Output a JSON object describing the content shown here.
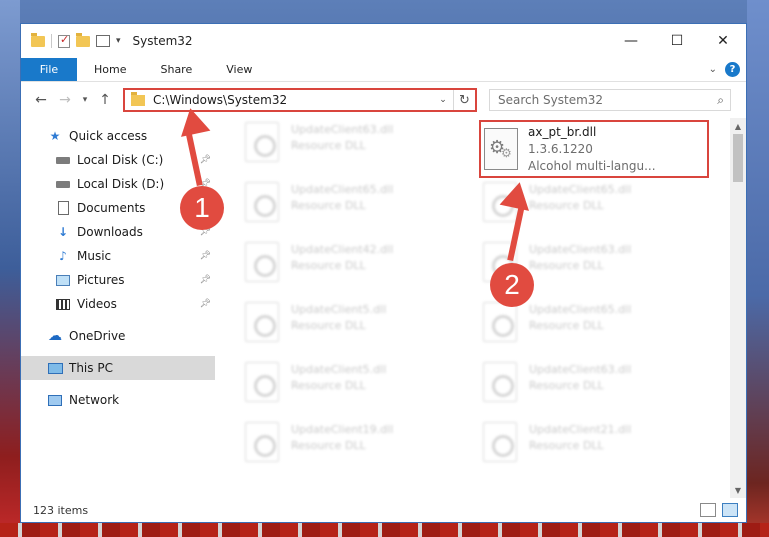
{
  "window": {
    "title": "System32",
    "controls": {
      "minimize": "—",
      "maximize": "☐",
      "close": "✕"
    }
  },
  "ribbon": {
    "tabs": [
      "File",
      "Home",
      "Share",
      "View"
    ],
    "help": "?"
  },
  "address": {
    "path": "C:\\Windows\\System32",
    "search_placeholder": "Search System32"
  },
  "sidebar": {
    "items": [
      {
        "label": "Quick access",
        "icon": "star-icon"
      },
      {
        "label": "Local Disk (C:)",
        "icon": "drive-icon"
      },
      {
        "label": "Local Disk (D:)",
        "icon": "drive-icon"
      },
      {
        "label": "Documents",
        "icon": "documents-icon"
      },
      {
        "label": "Downloads",
        "icon": "download-icon"
      },
      {
        "label": "Music",
        "icon": "music-icon"
      },
      {
        "label": "Pictures",
        "icon": "pictures-icon"
      },
      {
        "label": "Videos",
        "icon": "videos-icon"
      },
      {
        "label": "OneDrive",
        "icon": "cloud-icon"
      },
      {
        "label": "This PC",
        "icon": "computer-icon"
      },
      {
        "label": "Network",
        "icon": "network-icon"
      }
    ]
  },
  "files": {
    "ghost_left": [
      {
        "name": "UpdateClient63.dll",
        "type": "Resource DLL"
      },
      {
        "name": "UpdateClient65.dll",
        "type": "Resource DLL"
      },
      {
        "name": "UpdateClient42.dll",
        "type": "Resource DLL"
      },
      {
        "name": "UpdateClient5.dll",
        "type": "Resource DLL"
      },
      {
        "name": "UpdateClient5.dll",
        "type": "Resource DLL"
      },
      {
        "name": "UpdateClient19.dll",
        "type": "Resource DLL"
      }
    ],
    "ghost_right": [
      {
        "name": "UpdateClient65.dll",
        "type": "Resource DLL"
      },
      {
        "name": "UpdateClient63.dll",
        "type": "Resource DLL"
      },
      {
        "name": "UpdateClient65.dll",
        "type": "Resource DLL"
      },
      {
        "name": "UpdateClient63.dll",
        "type": "Resource DLL"
      },
      {
        "name": "UpdateClient21.dll",
        "type": "Resource DLL"
      }
    ],
    "highlighted": {
      "name": "ax_pt_br.dll",
      "version": "1.3.6.1220",
      "description": "Alcohol multi-langu..."
    }
  },
  "status": {
    "item_count": "123 items"
  },
  "annotations": {
    "step1": "1",
    "step2": "2"
  },
  "colors": {
    "accent": "#1979ca",
    "highlight": "#d9453d",
    "annotation": "#e14b40"
  }
}
